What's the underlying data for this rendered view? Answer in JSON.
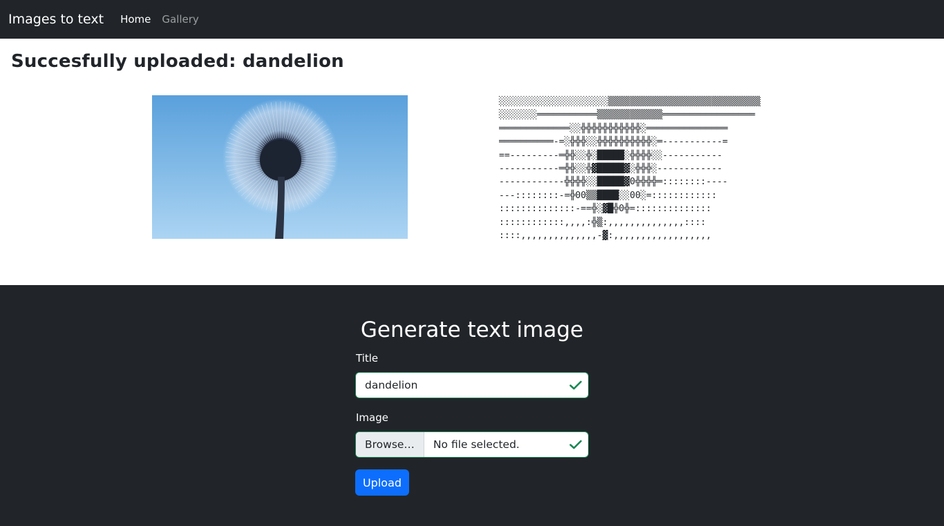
{
  "navbar": {
    "brand": "Images to text",
    "links": [
      {
        "label": "Home",
        "active": true
      },
      {
        "label": "Gallery",
        "active": false
      }
    ]
  },
  "result": {
    "heading": "Succesfully uploaded: dandelion",
    "image_subject": "dandelion seed head against blue sky",
    "ascii_art": "░░░░░░░░░░░░░░░░░░░░▒▒▒▒▒▒▒▒▒▒▒▒▒▒▒▒▒▒▒▒▒▒▒▒▒▒▒▒\n░░░░░░░═══════════▒▒▒▒▒▒▒▒▒▒▒▒═════════════════\n═════════════░░╬╬╬╬╬╬╬╬╬╬╬░═══════════════\n══════════-=░╬╬╬░░╬╬╬╬╬╬╬╬╬╬░═-----------=\n==---------═╬╬░░╬░█████░╬╬╬╬░░-----------\n-----------═╬╬░░╬▓█████▓░╬╬╬░------------\n------------╬╬╬╬░░█████▓0╬╬╬╬═::::::::----\n---::::::::-=╬00▒▒████░░00░=::::::::::::\n::::::::::::::-==╬░▓█╬0╬=::::::::::::::\n::::::::::::,,,,:╬▒:,,,,,,,,,,,,,,::::\n::::,,,,,,,,,,,,,,-▓:,,,,,,,,,,,,,,,,,,",
    "image_alt": "dandelion"
  },
  "form": {
    "heading": "Generate text image",
    "title_label": "Title",
    "title_value": "dandelion",
    "image_label": "Image",
    "browse_label": "Browse…",
    "file_status": "No file selected.",
    "upload_label": "Upload"
  },
  "colors": {
    "dark": "#212529",
    "valid": "#198754",
    "primary": "#0d6efd"
  }
}
